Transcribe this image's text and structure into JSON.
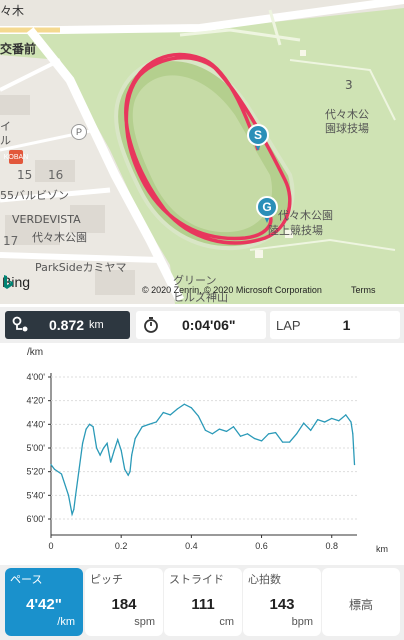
{
  "map": {
    "labels": {
      "top_left": "々木",
      "koban": "交番前",
      "area_3": "3",
      "park_baseball": "代々木公\n園球技場",
      "num_16": "16",
      "num_15": "15",
      "building_55": "55バルビゾン",
      "verdevista": "VERDEVISTA",
      "yoyogi_koen": "代々木公園",
      "num_17": "17",
      "parkside": "ParkSideカミヤマ",
      "athletics": "代々木公園",
      "athletics2": "陸上競技場",
      "green": "グリーン",
      "hills": "ヒルズ神山",
      "side_ru": "ル",
      "side_i": "イ"
    },
    "pin_start": "S",
    "pin_goal": "G",
    "poi_parking": "P",
    "koban_badge": "KOBAN",
    "bing": "Bing",
    "copyright": "© 2020 Zenrin, © 2020 Microsoft Corporation",
    "terms": "Terms"
  },
  "stats": {
    "distance_value": "0.872",
    "distance_unit": "km",
    "time_value": "0:04'06\"",
    "lap_label": "LAP",
    "lap_value": "1"
  },
  "colors": {
    "route": "#e8365d",
    "accent": "#1a91cc",
    "chart_line": "#2b9ab8"
  },
  "chart_data": {
    "type": "line",
    "ylabel": "/km",
    "xlabel": "km",
    "y_ticks": [
      "4'00'",
      "4'20'",
      "4'40'",
      "5'00'",
      "5'20'",
      "5'40'",
      "6'00'"
    ],
    "x_ticks": [
      "0",
      "0.2",
      "0.4",
      "0.6",
      "0.8"
    ],
    "xlim": [
      0,
      0.872
    ],
    "ylim_seconds": [
      230,
      370
    ],
    "x": [
      0,
      0.01,
      0.03,
      0.05,
      0.06,
      0.065,
      0.07,
      0.08,
      0.09,
      0.1,
      0.11,
      0.12,
      0.13,
      0.14,
      0.15,
      0.16,
      0.17,
      0.18,
      0.19,
      0.2,
      0.21,
      0.22,
      0.225,
      0.23,
      0.24,
      0.26,
      0.28,
      0.3,
      0.32,
      0.34,
      0.36,
      0.38,
      0.4,
      0.42,
      0.44,
      0.46,
      0.48,
      0.5,
      0.52,
      0.54,
      0.56,
      0.58,
      0.6,
      0.62,
      0.64,
      0.66,
      0.68,
      0.7,
      0.72,
      0.74,
      0.76,
      0.78,
      0.8,
      0.82,
      0.84,
      0.855,
      0.86,
      0.865
    ],
    "pace_seconds": [
      314,
      318,
      322,
      340,
      356,
      352,
      340,
      318,
      296,
      284,
      280,
      282,
      300,
      306,
      300,
      296,
      312,
      302,
      293,
      302,
      318,
      323,
      320,
      306,
      292,
      282,
      280,
      278,
      270,
      272,
      267,
      263,
      266,
      273,
      285,
      288,
      284,
      286,
      282,
      290,
      288,
      292,
      294,
      288,
      287,
      295,
      295,
      288,
      279,
      285,
      276,
      278,
      275,
      277,
      272,
      278,
      288,
      314
    ]
  },
  "metrics": [
    {
      "label": "ペース",
      "value": "4'42\"",
      "unit": "/km",
      "active": true
    },
    {
      "label": "ピッチ",
      "value": "184",
      "unit": "spm",
      "active": false
    },
    {
      "label": "ストライド",
      "value": "111",
      "unit": "cm",
      "active": false
    },
    {
      "label": "心拍数",
      "value": "143",
      "unit": "bpm",
      "active": false
    },
    {
      "label": "標高",
      "value": "",
      "unit": "",
      "active": false
    }
  ]
}
